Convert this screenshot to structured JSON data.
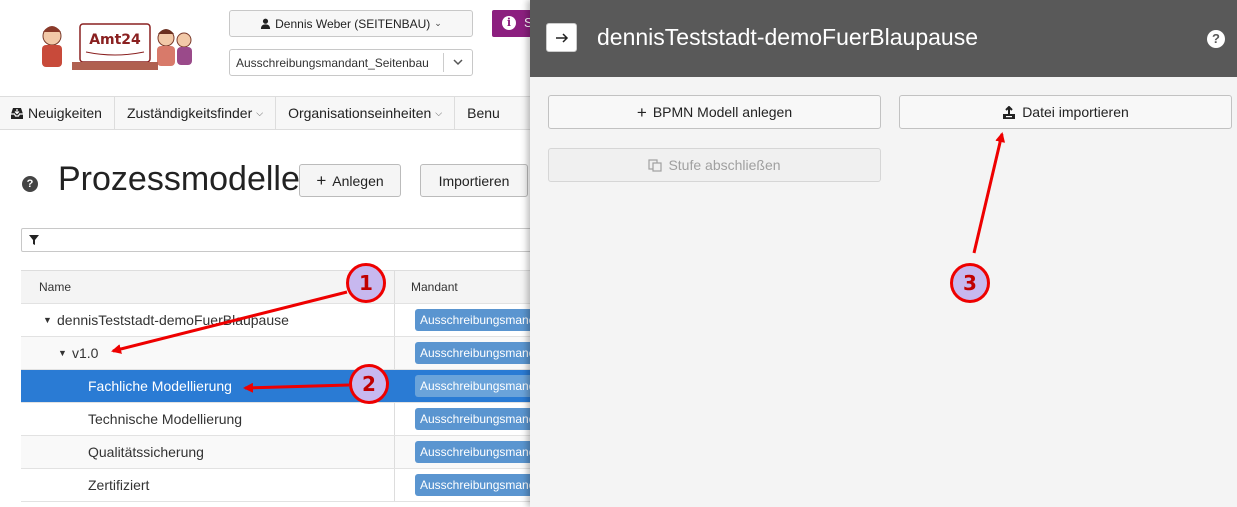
{
  "header": {
    "logo_text": "Amt24",
    "user_button": "Dennis Weber (SEITENBAU)",
    "mandant_select_value": "Ausschreibungsmandant_Seitenbau",
    "purple_button_fragment": "S"
  },
  "nav": {
    "items": [
      {
        "label": "Neuigkeiten",
        "icon": "inbox-icon"
      },
      {
        "label": "Zuständigkeitsfinder"
      },
      {
        "label": "Organisationseinheiten"
      },
      {
        "label": "Benu"
      }
    ]
  },
  "page": {
    "title": "Prozessmodelle",
    "anlegen_label": "Anlegen",
    "importieren_label": "Importieren"
  },
  "table": {
    "headers": {
      "name": "Name",
      "mandant": "Mandant"
    },
    "rows": [
      {
        "name": "dennisTeststadt-demoFuerBlaupause",
        "mandant": "Ausschreibungsmandant_Seitenbau",
        "level": 1,
        "toggle": "▼"
      },
      {
        "name": "v1.0",
        "mandant": "Ausschreibungsmandant_Seitenbau",
        "level": 2,
        "toggle": "▼"
      },
      {
        "name": "Fachliche Modellierung",
        "mandant": "Ausschreibungsmandant_Seitenbau",
        "level": 3,
        "selected": true
      },
      {
        "name": "Technische Modellierung",
        "mandant": "Ausschreibungsmandant_Seitenbau",
        "level": 3
      },
      {
        "name": "Qualitätssicherung",
        "mandant": "Ausschreibungsmandant_Seitenbau",
        "level": 3
      },
      {
        "name": "Zertifiziert",
        "mandant": "Ausschreibungsmandant_Seitenbau",
        "level": 3
      }
    ]
  },
  "panel": {
    "title": "dennisTeststadt-demoFuerBlaupause",
    "help_glyph": "?",
    "bpmn_button": "BPMN Modell anlegen",
    "import_button": "Datei importieren",
    "stufe_button": "Stufe abschließen"
  },
  "annotations": {
    "badges": [
      "1",
      "2",
      "3"
    ],
    "color": "#ee0000"
  },
  "colors": {
    "selected_row": "#2a7bd4",
    "panel_header": "#595959",
    "mandant_pill": "#5a95d0",
    "purple_accent": "#8c1f7f"
  }
}
